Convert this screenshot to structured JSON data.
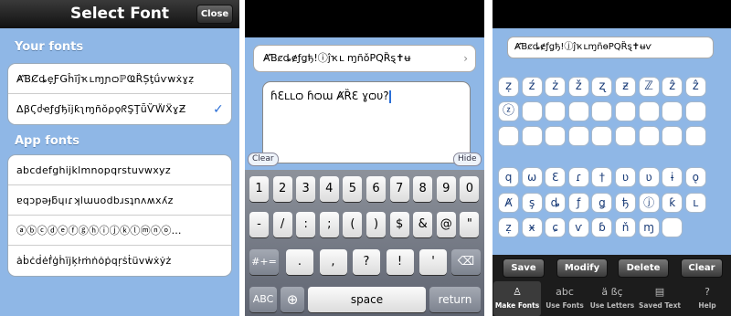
{
  "select_font": {
    "title": "Select Font",
    "close_label": "Close",
    "your_fonts_header": "Your fonts",
    "your_fonts": [
      {
        "label": "ȺƁȻȡȩƑǤĥĩĵҡʟɱɲѻℙҨȐȘƫǘѵwẋɣẓ",
        "selected": false
      },
      {
        "label": "ΔβϚძҽƒɠђĭϳƙʅɱñŏρϙᖇŞŢǖѶẄẌɣƵ",
        "selected": true
      }
    ],
    "app_fonts_header": "App fonts",
    "app_fonts": [
      {
        "label": "abcdefghijklmnopqrstuvwxyz"
      },
      {
        "label": "ɐqɔpǝɟƃɥıɾʞlɯuodbɹsʇnʌʍxʎz"
      },
      {
        "label": "ⓐⓑⓒⓓⓔⓕⓖⓗⓘⓙⓚⓛⓜⓝⓞ…"
      },
      {
        "label": "ȧḃċḋėḟġḣïjķŀṁṅȯṗqŗṡṫüvẇẋẏż"
      }
    ]
  },
  "keyboard_screen": {
    "font_field": "ȺƁȼȡɇƒǥђ!ⓘĵҡʟ ɱñǒPQȐȿ✝ʉ",
    "font_field_chevron": "›",
    "text": "ɦƐʟʟѻ ɦѻɯ ȺȐƐ ɣѻυ?",
    "clear_label": "Clear",
    "hide_label": "Hide",
    "row1": [
      "1",
      "2",
      "3",
      "4",
      "5",
      "6",
      "7",
      "8",
      "9",
      "0"
    ],
    "row2": [
      "-",
      "/",
      ":",
      ";",
      "(",
      ")",
      "$",
      "&",
      "@",
      "\""
    ],
    "row3": [
      ".",
      ",",
      "?",
      "!",
      "'"
    ],
    "sym_label": "#+=",
    "backspace_label": "⌫",
    "abc_label": "ABC",
    "globe_label": "⊕",
    "space_label": "space",
    "return_label": "return"
  },
  "make_fonts": {
    "font_field": "ȺƁȼȡɇƒǥђ!ⓙĵҡʟɱñɵPQȐȿ✝ʉѵ",
    "upper_row1": [
      "ẓ",
      "ź",
      "ż",
      "ž",
      "ʐ",
      "ƶ",
      "ℤ",
      "ẑ",
      "ẑ"
    ],
    "upper_row2": [
      "ⓩ",
      "",
      "",
      "",
      "",
      "",
      "",
      "",
      ""
    ],
    "lower_row1": [
      "q",
      "ω",
      "Ɛ",
      "ɾ",
      "†",
      "ʋ",
      "ʋ",
      "ɨ",
      "ǫ"
    ],
    "lower_row2": [
      "Ⱥ",
      "ş",
      "ȡ",
      "ƒ",
      "ǥ",
      "ђ",
      "ⓙ",
      "ƙ",
      "ʟ"
    ],
    "lower_row3": [
      "ẓ",
      "ӿ",
      "ɕ",
      "ѵ",
      "ɓ",
      "ň",
      "ɱ",
      ""
    ],
    "actions": [
      "Save",
      "Modify",
      "Delete",
      "Clear"
    ],
    "tabs": [
      {
        "icon": "♙",
        "label": "Make Fonts",
        "active": true
      },
      {
        "icon": "abc",
        "label": "Use Fonts",
        "active": false
      },
      {
        "icon": "ä ßç",
        "label": "Use Letters",
        "active": false
      },
      {
        "icon": "▤",
        "label": "Saved Text",
        "active": false
      },
      {
        "icon": "?",
        "label": "Help",
        "active": false
      }
    ]
  }
}
